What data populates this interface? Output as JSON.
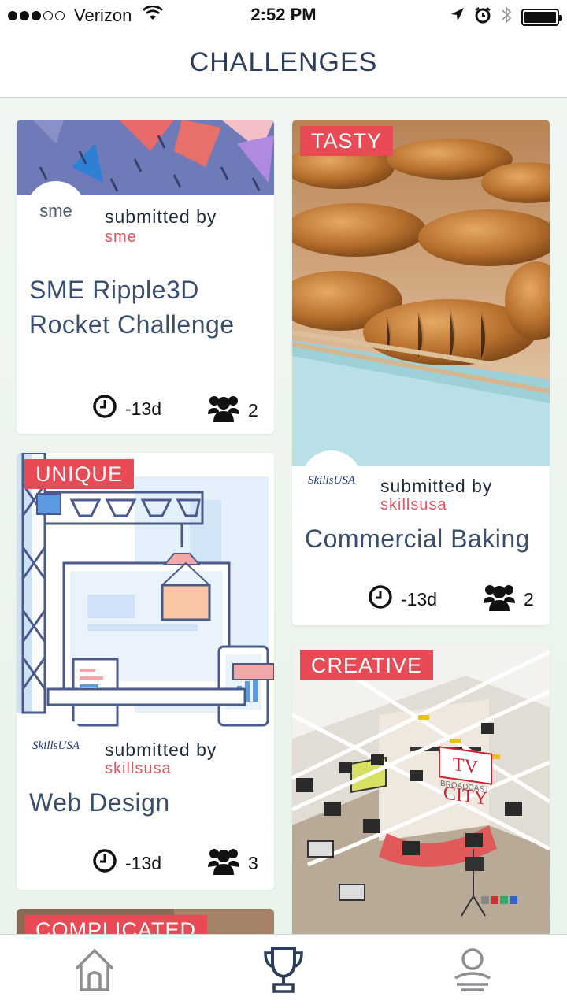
{
  "status": {
    "carrier": "Verizon",
    "time": "2:52 PM"
  },
  "header": {
    "title": "CHALLENGES"
  },
  "cards": [
    {
      "tag": "",
      "logo": "sme",
      "submitted_label": "submitted by",
      "submitter": "sme",
      "title_line1": "SME Ripple3D",
      "title_line2": "Rocket Challenge",
      "days": "-13d",
      "members": "2"
    },
    {
      "tag": "TASTY",
      "logo": "SkillsUSA",
      "submitted_label": "submitted by",
      "submitter": "skillsusa",
      "title_line1": "Commercial Baking",
      "days": "-13d",
      "members": "2"
    },
    {
      "tag": "UNIQUE",
      "logo": "SkillsUSA",
      "submitted_label": "submitted by",
      "submitter": "skillsusa",
      "title_line1": "Web Design",
      "days": "-13d",
      "members": "3"
    },
    {
      "tag": "CREATIVE",
      "image_text_1": "TV CITY",
      "image_text_2": "BROADCAST"
    },
    {
      "tag": "COMPLICATED"
    }
  ],
  "tabs": [
    {
      "icon": "home-icon",
      "active": false
    },
    {
      "icon": "trophy-icon",
      "active": true
    },
    {
      "icon": "profile-icon",
      "active": false
    }
  ],
  "colors": {
    "tag": "#e84b55",
    "accent": "#2c3e5a",
    "submitter": "#e0555f"
  }
}
